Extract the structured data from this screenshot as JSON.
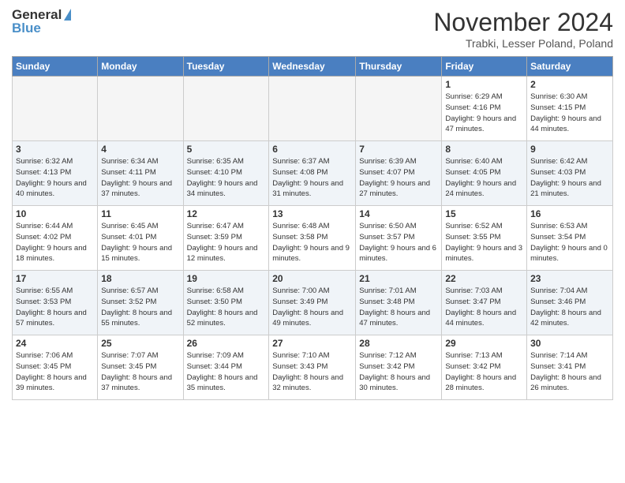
{
  "logo": {
    "line1": "General",
    "line2": "Blue"
  },
  "title": "November 2024",
  "subtitle": "Trabki, Lesser Poland, Poland",
  "days_header": [
    "Sunday",
    "Monday",
    "Tuesday",
    "Wednesday",
    "Thursday",
    "Friday",
    "Saturday"
  ],
  "weeks": [
    [
      {
        "day": "",
        "info": ""
      },
      {
        "day": "",
        "info": ""
      },
      {
        "day": "",
        "info": ""
      },
      {
        "day": "",
        "info": ""
      },
      {
        "day": "",
        "info": ""
      },
      {
        "day": "1",
        "info": "Sunrise: 6:29 AM\nSunset: 4:16 PM\nDaylight: 9 hours\nand 47 minutes."
      },
      {
        "day": "2",
        "info": "Sunrise: 6:30 AM\nSunset: 4:15 PM\nDaylight: 9 hours\nand 44 minutes."
      }
    ],
    [
      {
        "day": "3",
        "info": "Sunrise: 6:32 AM\nSunset: 4:13 PM\nDaylight: 9 hours\nand 40 minutes."
      },
      {
        "day": "4",
        "info": "Sunrise: 6:34 AM\nSunset: 4:11 PM\nDaylight: 9 hours\nand 37 minutes."
      },
      {
        "day": "5",
        "info": "Sunrise: 6:35 AM\nSunset: 4:10 PM\nDaylight: 9 hours\nand 34 minutes."
      },
      {
        "day": "6",
        "info": "Sunrise: 6:37 AM\nSunset: 4:08 PM\nDaylight: 9 hours\nand 31 minutes."
      },
      {
        "day": "7",
        "info": "Sunrise: 6:39 AM\nSunset: 4:07 PM\nDaylight: 9 hours\nand 27 minutes."
      },
      {
        "day": "8",
        "info": "Sunrise: 6:40 AM\nSunset: 4:05 PM\nDaylight: 9 hours\nand 24 minutes."
      },
      {
        "day": "9",
        "info": "Sunrise: 6:42 AM\nSunset: 4:03 PM\nDaylight: 9 hours\nand 21 minutes."
      }
    ],
    [
      {
        "day": "10",
        "info": "Sunrise: 6:44 AM\nSunset: 4:02 PM\nDaylight: 9 hours\nand 18 minutes."
      },
      {
        "day": "11",
        "info": "Sunrise: 6:45 AM\nSunset: 4:01 PM\nDaylight: 9 hours\nand 15 minutes."
      },
      {
        "day": "12",
        "info": "Sunrise: 6:47 AM\nSunset: 3:59 PM\nDaylight: 9 hours\nand 12 minutes."
      },
      {
        "day": "13",
        "info": "Sunrise: 6:48 AM\nSunset: 3:58 PM\nDaylight: 9 hours\nand 9 minutes."
      },
      {
        "day": "14",
        "info": "Sunrise: 6:50 AM\nSunset: 3:57 PM\nDaylight: 9 hours\nand 6 minutes."
      },
      {
        "day": "15",
        "info": "Sunrise: 6:52 AM\nSunset: 3:55 PM\nDaylight: 9 hours\nand 3 minutes."
      },
      {
        "day": "16",
        "info": "Sunrise: 6:53 AM\nSunset: 3:54 PM\nDaylight: 9 hours\nand 0 minutes."
      }
    ],
    [
      {
        "day": "17",
        "info": "Sunrise: 6:55 AM\nSunset: 3:53 PM\nDaylight: 8 hours\nand 57 minutes."
      },
      {
        "day": "18",
        "info": "Sunrise: 6:57 AM\nSunset: 3:52 PM\nDaylight: 8 hours\nand 55 minutes."
      },
      {
        "day": "19",
        "info": "Sunrise: 6:58 AM\nSunset: 3:50 PM\nDaylight: 8 hours\nand 52 minutes."
      },
      {
        "day": "20",
        "info": "Sunrise: 7:00 AM\nSunset: 3:49 PM\nDaylight: 8 hours\nand 49 minutes."
      },
      {
        "day": "21",
        "info": "Sunrise: 7:01 AM\nSunset: 3:48 PM\nDaylight: 8 hours\nand 47 minutes."
      },
      {
        "day": "22",
        "info": "Sunrise: 7:03 AM\nSunset: 3:47 PM\nDaylight: 8 hours\nand 44 minutes."
      },
      {
        "day": "23",
        "info": "Sunrise: 7:04 AM\nSunset: 3:46 PM\nDaylight: 8 hours\nand 42 minutes."
      }
    ],
    [
      {
        "day": "24",
        "info": "Sunrise: 7:06 AM\nSunset: 3:45 PM\nDaylight: 8 hours\nand 39 minutes."
      },
      {
        "day": "25",
        "info": "Sunrise: 7:07 AM\nSunset: 3:45 PM\nDaylight: 8 hours\nand 37 minutes."
      },
      {
        "day": "26",
        "info": "Sunrise: 7:09 AM\nSunset: 3:44 PM\nDaylight: 8 hours\nand 35 minutes."
      },
      {
        "day": "27",
        "info": "Sunrise: 7:10 AM\nSunset: 3:43 PM\nDaylight: 8 hours\nand 32 minutes."
      },
      {
        "day": "28",
        "info": "Sunrise: 7:12 AM\nSunset: 3:42 PM\nDaylight: 8 hours\nand 30 minutes."
      },
      {
        "day": "29",
        "info": "Sunrise: 7:13 AM\nSunset: 3:42 PM\nDaylight: 8 hours\nand 28 minutes."
      },
      {
        "day": "30",
        "info": "Sunrise: 7:14 AM\nSunset: 3:41 PM\nDaylight: 8 hours\nand 26 minutes."
      }
    ]
  ]
}
